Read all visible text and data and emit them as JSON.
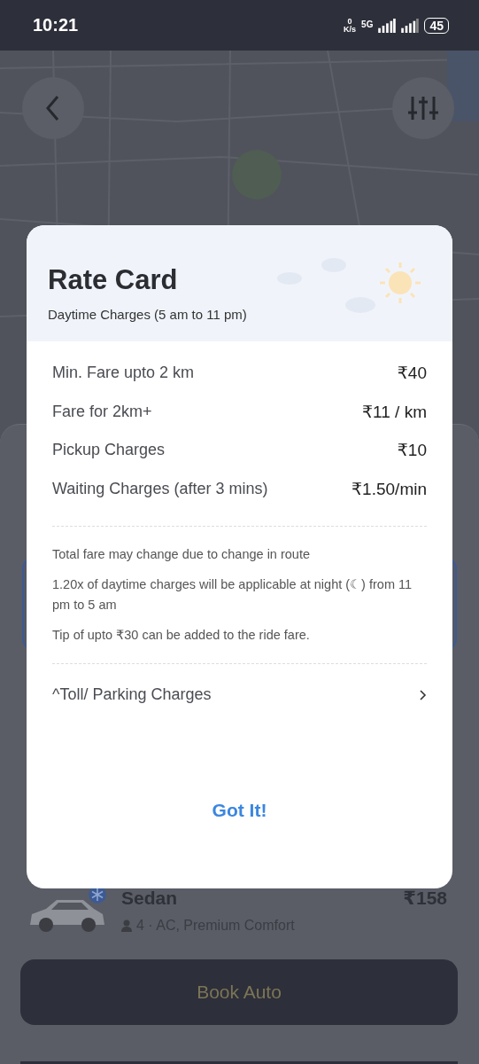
{
  "status_bar": {
    "time": "10:21",
    "speed_value": "0",
    "speed_unit": "K/s",
    "network": "5G",
    "battery": "45"
  },
  "ride_option": {
    "name": "Sedan",
    "price": "₹158",
    "details": "4 · AC, Premium Comfort"
  },
  "book_button": {
    "label": "Book Auto"
  },
  "rate_card": {
    "title": "Rate Card",
    "subtitle": "Daytime Charges (5 am to 11 pm)",
    "charges": [
      {
        "label": "Min. Fare upto 2 km",
        "value": "₹40"
      },
      {
        "label": "Fare for 2km+",
        "value": "₹11 / km"
      },
      {
        "label": "Pickup Charges",
        "value": "₹10"
      },
      {
        "label": "Waiting Charges (after 3 mins)",
        "value": "₹1.50/min"
      }
    ],
    "notes": [
      "Total fare may change due to change in route",
      "1.20x of daytime charges will be applicable at night (☾) from 11 pm to 5 am",
      "Tip of upto ₹30 can be added to the ride fare."
    ],
    "toll_link": "^Toll/ Parking Charges",
    "confirm_button": "Got It!"
  }
}
